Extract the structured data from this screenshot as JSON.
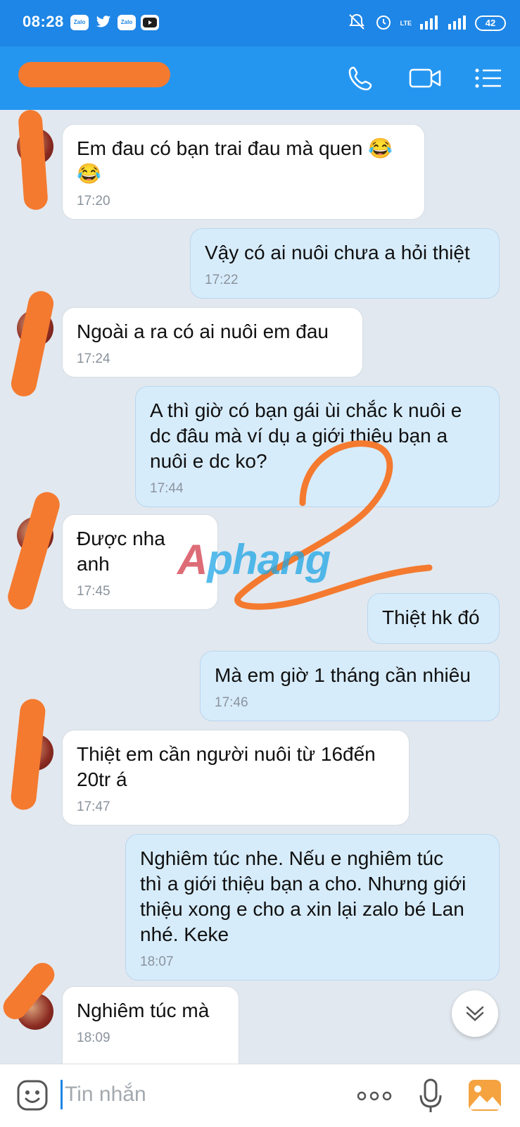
{
  "status_bar": {
    "time": "08:28",
    "notifications": [
      {
        "icon": "zalo-icon",
        "label": "Zalo"
      },
      {
        "icon": "twitter-icon",
        "label": ""
      },
      {
        "icon": "zalo-icon",
        "label": "Zalo"
      },
      {
        "icon": "youtube-icon",
        "label": ""
      }
    ],
    "network_label": "LTE",
    "battery": "42"
  },
  "header": {
    "icons": [
      "phone-icon",
      "video-call-icon",
      "menu-icon"
    ],
    "accent_color": "#2596f0"
  },
  "messages": [
    {
      "side": "in",
      "lines": [
        "Em đau có bạn trai đau mà quen 😂",
        "😂"
      ],
      "time": "17:20"
    },
    {
      "side": "out",
      "lines": [
        "Vậy có ai nuôi chưa a hỏi thiệt"
      ],
      "time": "17:22"
    },
    {
      "side": "in",
      "lines": [
        "Ngoài a ra có ai nuôi em đau"
      ],
      "time": "17:24"
    },
    {
      "side": "out",
      "lines": [
        "A thì giờ có bạn gái ùi chắc k nuôi e",
        "dc đâu mà ví dụ a giới thiệu bạn a",
        "nuôi e dc ko?"
      ],
      "time": "17:44"
    },
    {
      "side": "in",
      "lines": [
        "Được nha anh"
      ],
      "time": "17:45"
    },
    {
      "side": "out",
      "lines": [
        "Thiệt hk đó"
      ],
      "time": ""
    },
    {
      "side": "out",
      "lines": [
        "Mà em giờ 1 tháng cần nhiêu"
      ],
      "time": "17:46"
    },
    {
      "side": "in",
      "lines": [
        "Thiệt em cần người nuôi từ 16đến",
        "20tr á"
      ],
      "time": "17:47"
    },
    {
      "side": "out",
      "lines": [
        "Nghiêm túc nhe. Nếu e nghiêm túc",
        "thì a giới thiệu bạn a cho. Nhưng giới",
        "thiệu xong e cho a xin lại zalo bé Lan",
        "nhé. Keke"
      ],
      "time": "18:07"
    },
    {
      "side": "in",
      "lines": [
        "Nghiêm túc mà"
      ],
      "time": "18:09"
    }
  ],
  "watermark": {
    "part1": "A",
    "part2": "phang"
  },
  "composer": {
    "placeholder": "Tin nhắn",
    "icons": [
      "emoji-sticker-icon",
      "more-icon",
      "microphone-icon",
      "gallery-icon"
    ]
  },
  "scroll_button_icon": "chevron-down-icon"
}
